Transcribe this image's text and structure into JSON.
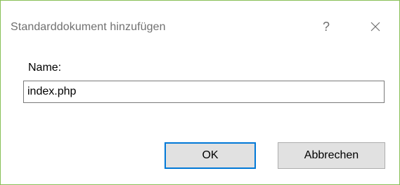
{
  "window": {
    "title": "Standarddokument hinzufügen",
    "help_glyph": "?",
    "close_icon": "close-icon"
  },
  "form": {
    "name_label": "Name:",
    "name_value": "index.php"
  },
  "buttons": {
    "ok_label": "OK",
    "cancel_label": "Abbrechen"
  },
  "colors": {
    "accent_focus": "#0078d7",
    "frame_border": "#88c057",
    "button_face": "#e1e1e1"
  }
}
